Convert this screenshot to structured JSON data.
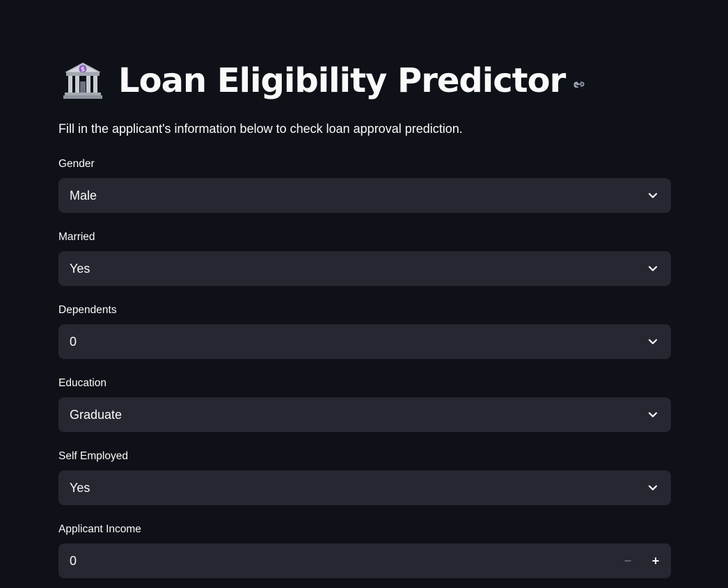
{
  "header": {
    "title": "Loan Eligibility Predictor",
    "icon": "bank-building-icon",
    "subtitle": "Fill in the applicant's information below to check loan approval prediction."
  },
  "form": {
    "gender": {
      "label": "Gender",
      "value": "Male"
    },
    "married": {
      "label": "Married",
      "value": "Yes"
    },
    "dependents": {
      "label": "Dependents",
      "value": "0"
    },
    "education": {
      "label": "Education",
      "value": "Graduate"
    },
    "self_employed": {
      "label": "Self Employed",
      "value": "Yes"
    },
    "applicant_income": {
      "label": "Applicant Income",
      "value": "0",
      "minus": "−",
      "plus": "+"
    }
  },
  "colors": {
    "background": "#0e1117",
    "input_bg": "#262730",
    "text": "#fafafa"
  }
}
